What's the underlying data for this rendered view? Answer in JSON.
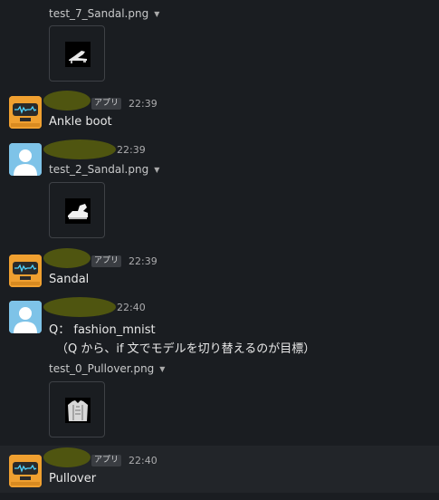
{
  "messages": {
    "m1": {
      "file_name": "test_7_Sandal.png"
    },
    "m2": {
      "badge": "アプリ",
      "time": "22:39",
      "text": "Ankle boot"
    },
    "m3": {
      "time": "22:39",
      "file_name": "test_2_Sandal.png"
    },
    "m4": {
      "badge": "アプリ",
      "time": "22:39",
      "text": "Sandal"
    },
    "m5": {
      "time": "22:40",
      "line1": "Q： fashion_mnist",
      "line2": "（Q から、if 文でモデルを切り替えるのが目標）",
      "file_name": "test_0_Pullover.png"
    },
    "m6": {
      "badge": "アプリ",
      "time": "22:40",
      "text": "Pullover"
    }
  },
  "colors": {
    "background": "#1a1d21",
    "redaction_blob": "#4f5510",
    "bot_avatar": "#f0a030",
    "user_avatar": "#7ec3e8"
  },
  "icons": {
    "dropdown": "caret-down-icon",
    "bot_avatar": "robot-avatar-icon",
    "user_avatar": "person-avatar-icon"
  }
}
